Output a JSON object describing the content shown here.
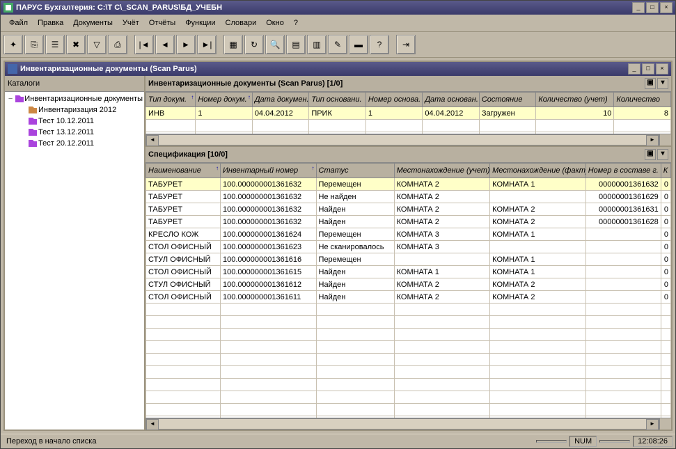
{
  "window": {
    "title": "ПАРУС Бухгалтерия: C:\\T C\\_SCAN_PARUS\\БД_УЧЕБН"
  },
  "menu": [
    "Файл",
    "Правка",
    "Документы",
    "Учёт",
    "Отчёты",
    "Функции",
    "Словари",
    "Окно",
    "?"
  ],
  "toolbar_icons": [
    "new-doc",
    "copy",
    "props",
    "delete",
    "filter",
    "print",
    "_sep",
    "first",
    "prev",
    "next",
    "last",
    "_sep",
    "calendar",
    "refresh",
    "find",
    "catalog",
    "chart",
    "tools",
    "label",
    "help",
    "_sep",
    "exit"
  ],
  "child": {
    "title": "Инвентаризационные документы (Scan Parus)"
  },
  "tree": {
    "header": "Каталоги",
    "root": {
      "label": "Инвентаризационные документы"
    },
    "items": [
      {
        "label": "Инвентаризация 2012",
        "icon": "book-open"
      },
      {
        "label": "Тест 10.12.2011",
        "icon": "book"
      },
      {
        "label": "Тест 13.12.2011",
        "icon": "book"
      },
      {
        "label": "Тест 20.12.2011",
        "icon": "book"
      }
    ]
  },
  "grid1": {
    "header": "Инвентаризационные документы (Scan Parus) [1/0]",
    "columns": [
      "Тип докум.",
      "Номер докум.",
      "Дата докумен.",
      "Тип основани.",
      "Номер основа.",
      "Дата основан.",
      "Состояние",
      "Количество (учет)",
      "Количество"
    ],
    "widths": [
      70,
      80,
      80,
      80,
      80,
      80,
      80,
      110,
      80
    ],
    "sorted_cols": [
      0,
      1
    ],
    "rows": [
      {
        "sel": true,
        "cells": [
          "ИНВ",
          "1",
          "04.04.2012",
          "ПРИК",
          "1",
          "04.04.2012",
          "Загружен",
          "10",
          "8"
        ]
      }
    ],
    "empty_rows": 2
  },
  "grid2": {
    "header": "Спецификация [10/0]",
    "columns": [
      "Наименование",
      "Инвентарный номер",
      "Статус",
      "Местонахождение (учет)",
      "Местонахождение (факт)",
      "Номер в составе г.",
      "К"
    ],
    "widths": [
      105,
      135,
      110,
      135,
      135,
      106,
      14
    ],
    "sorted_cols": [
      0,
      1
    ],
    "rows": [
      {
        "sel": true,
        "cells": [
          "ТАБУРЕТ",
          "100.000000001361632",
          "Перемещен",
          "КОМНАТА 2",
          "КОМНАТА 1",
          "00000001361632",
          "0"
        ]
      },
      {
        "cells": [
          "ТАБУРЕТ",
          "100.000000001361632",
          "Не найден",
          "КОМНАТА 2",
          "",
          "00000001361629",
          "0"
        ]
      },
      {
        "cells": [
          "ТАБУРЕТ",
          "100.000000001361632",
          "Найден",
          "КОМНАТА 2",
          "КОМНАТА 2",
          "00000001361631",
          "0"
        ]
      },
      {
        "cells": [
          "ТАБУРЕТ",
          "100.000000001361632",
          "Найден",
          "КОМНАТА 2",
          "КОМНАТА 2",
          "00000001361628",
          "0"
        ]
      },
      {
        "cells": [
          "КРЕСЛО КОЖ",
          "100.000000001361624",
          "Перемещен",
          "КОМНАТА 3",
          "КОМНАТА 1",
          "",
          "0"
        ]
      },
      {
        "cells": [
          "СТОЛ ОФИСНЫЙ",
          "100.000000001361623",
          "Не сканировалось",
          "КОМНАТА 3",
          "",
          "",
          "0"
        ]
      },
      {
        "cells": [
          "СТУЛ ОФИСНЫЙ",
          "100.000000001361616",
          "Перемещен",
          "",
          "КОМНАТА 1",
          "",
          "0"
        ]
      },
      {
        "cells": [
          "СТОЛ ОФИСНЫЙ",
          "100.000000001361615",
          "Найден",
          "КОМНАТА 1",
          "КОМНАТА 1",
          "",
          "0"
        ]
      },
      {
        "cells": [
          "СТУЛ ОФИСНЫЙ",
          "100.000000001361612",
          "Найден",
          "КОМНАТА 2",
          "КОМНАТА 2",
          "",
          "0"
        ]
      },
      {
        "cells": [
          "СТОЛ ОФИСНЫЙ",
          "100.000000001361611",
          "Найден",
          "КОМНАТА 2",
          "КОМНАТА 2",
          "",
          "0"
        ]
      }
    ],
    "empty_rows": 10
  },
  "status": {
    "text": "Переход в начало списка",
    "num": "NUM",
    "time": "12:08:26"
  }
}
